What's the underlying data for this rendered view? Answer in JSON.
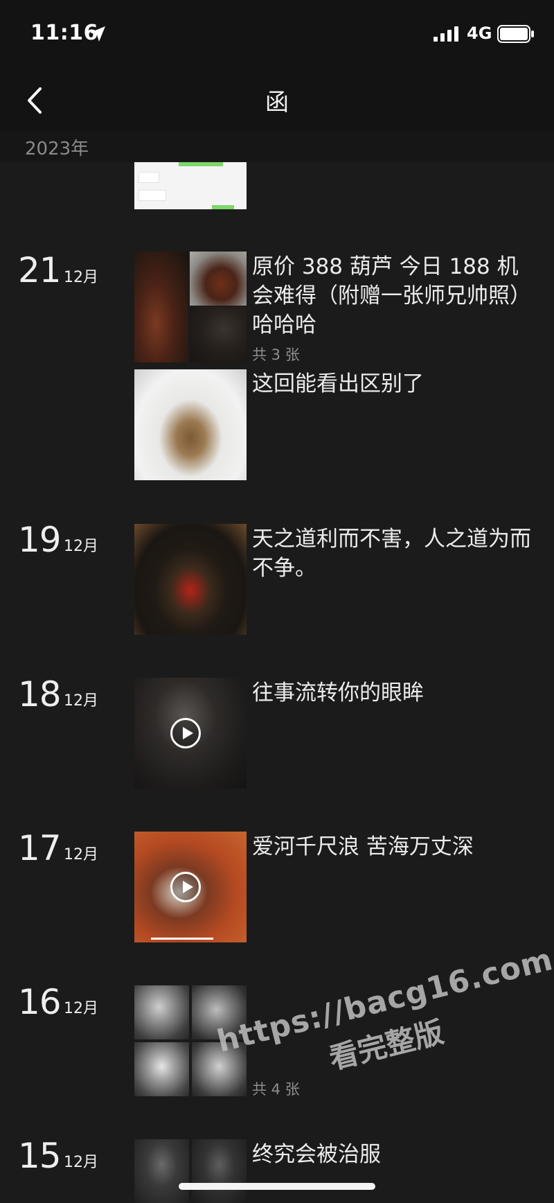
{
  "status_bar": {
    "time": "11:16",
    "network": "4G",
    "icons": [
      "location-arrow-icon",
      "signal-icon",
      "battery-icon"
    ]
  },
  "nav": {
    "title": "函",
    "back_icon": "chevron-left-icon"
  },
  "year_header": "2023年",
  "posts": [
    {
      "day": "21",
      "month": "12月",
      "text": "原价 388 葫芦  今日 188 机会难得（附赠一张师兄帅照）哈哈哈",
      "count": "共 3 张"
    },
    {
      "text": "这回能看出区别了"
    },
    {
      "day": "19",
      "month": "12月",
      "text": "天之道利而不害，人之道为而不争。"
    },
    {
      "day": "18",
      "month": "12月",
      "text": "往事流转你的眼眸",
      "media": "video"
    },
    {
      "day": "17",
      "month": "12月",
      "text": "爱河千尺浪 苦海万丈深",
      "media": "video"
    },
    {
      "day": "16",
      "month": "12月",
      "text": "",
      "count": "共 4 张"
    },
    {
      "day": "15",
      "month": "12月",
      "text": "终究会被治服"
    }
  ],
  "watermark": {
    "url": "https://bacg16.com",
    "text": "看完整版"
  },
  "colors": {
    "background": "#1b1b1b",
    "bar": "#131313",
    "text": "#ececec",
    "muted": "#8f8f8f"
  }
}
